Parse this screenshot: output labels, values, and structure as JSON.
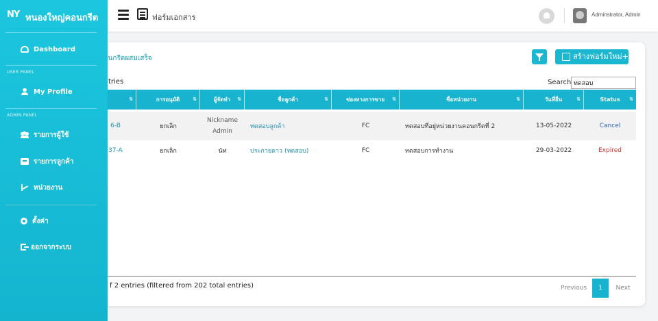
{
  "app": {
    "brand_logo": "NY",
    "brand_name": "หนองใหญ่คอนกรีต"
  },
  "header": {
    "page_title": "ฟอร์มเอกสาร",
    "user_name": "Adminstrator, Admin"
  },
  "sidebar": {
    "items": [
      {
        "label": "Dashboard",
        "icon": "gauge-icon"
      },
      {
        "label": "My Profile",
        "icon": "user-icon"
      },
      {
        "label": "รายการผู้ใช้",
        "icon": "users-icon"
      },
      {
        "label": "รายการลูกค้า",
        "icon": "address-card-icon"
      },
      {
        "label": "หน่วยงาน",
        "icon": "sitemap-icon"
      },
      {
        "label": "ตั้งค่า",
        "icon": "gear-icon"
      },
      {
        "label": "ออกจากระบบ",
        "icon": "sign-out-icon"
      }
    ],
    "sections": {
      "user_panel": "USER PANEL",
      "admin_panel": "ADMIN PANEL"
    }
  },
  "main": {
    "toast": "นคอนกรีตผสมเสร็จ",
    "create_button": "สร้างฟอร์มใหม่+",
    "entries_label": "tries",
    "search_label": "Search:",
    "search_value": "ทดสอบ",
    "footer_info": "f 2 entries (filtered from 202 total entries)",
    "pagination": {
      "prev": "Previous",
      "current": "1",
      "next": "Next"
    }
  },
  "table": {
    "columns": [
      "",
      "การอนุมัติ",
      "ผู้จัดทำ",
      "ชื่อลูกค้า",
      "ช่องทางการขาย",
      "ชื่อหน่วยงาน",
      "วันที่ยื่น",
      "Status"
    ],
    "rows": [
      {
        "id": "6-B",
        "approval": "ยกเลิก",
        "author_1": "Nickname",
        "author_2": "Admin",
        "customer": "ทดสอบลูกค้า",
        "channel": "FC",
        "unit": "ทดสอบที่อยู่หน่วยงานคอนกรีตที่ 2",
        "date": "13-05-2022",
        "status": "Cancel"
      },
      {
        "id": "37-A",
        "approval": "ยกเลิก",
        "author_1": "นัท",
        "author_2": "",
        "customer": "ประกายดาว (ทดสอบ)",
        "channel": "FC",
        "unit": "ทดสอบการทำงาน",
        "date": "29-03-2022",
        "status": "Expired"
      }
    ]
  }
}
